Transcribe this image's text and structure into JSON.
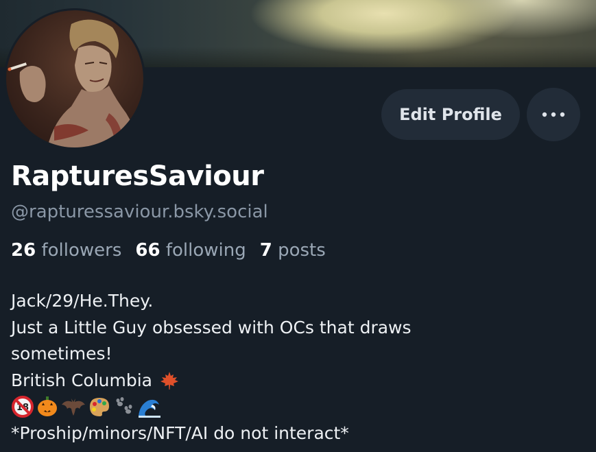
{
  "profile": {
    "display_name": "RapturesSaviour",
    "handle": "@rapturessaviour.bsky.social",
    "stats": {
      "followers_count": "26",
      "followers_label": "followers",
      "following_count": "66",
      "following_label": "following",
      "posts_count": "7",
      "posts_label": "posts"
    },
    "bio": {
      "line1": "Jack/29/He.They.",
      "line2": "Just a Little Guy obsessed with OCs that draws",
      "line3": "sometimes!",
      "line4": "British Columbia",
      "line4_emoji": "maple-leaf-icon",
      "emoji_row": [
        "no-under-18-icon",
        "jack-o-lantern-icon",
        "bat-icon",
        "artist-palette-icon",
        "paw-prints-icon",
        "water-wave-icon"
      ],
      "line6": "*Proship/minors/NFT/AI do not interact*"
    }
  },
  "actions": {
    "edit_profile_label": "Edit Profile",
    "more_icon": "ellipsis-icon"
  },
  "colors": {
    "background": "#161e27",
    "button_bg": "#222c38",
    "muted_text": "#8a97a6"
  }
}
